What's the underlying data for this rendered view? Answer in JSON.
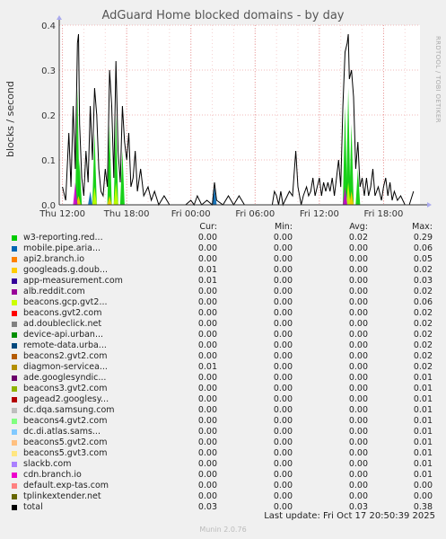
{
  "chart_data": {
    "type": "area",
    "title": "AdGuard Home blocked domains - by day",
    "ylabel": "blocks / second",
    "ylim": [
      0,
      0.4
    ],
    "yticks": [
      "0.0",
      "0.1",
      "0.2",
      "0.3",
      "0.4"
    ],
    "ytick_values": [
      0,
      0.1,
      0.2,
      0.3,
      0.4
    ],
    "xticks": [
      "Thu 12:00",
      "Thu 18:00",
      "Fri 00:00",
      "Fri 06:00",
      "Fri 12:00",
      "Fri 18:00"
    ],
    "xtick_hours": [
      0,
      6,
      12,
      18,
      24,
      30
    ],
    "xlim_hours": [
      -0.3,
      33.4
    ],
    "grid": true,
    "total_series": {
      "name": "total",
      "points": [
        [
          0.0,
          0.04
        ],
        [
          0.3,
          0.01
        ],
        [
          0.6,
          0.16
        ],
        [
          0.8,
          0.04
        ],
        [
          1.0,
          0.22
        ],
        [
          1.2,
          0.08
        ],
        [
          1.4,
          0.36
        ],
        [
          1.5,
          0.38
        ],
        [
          1.6,
          0.18
        ],
        [
          1.8,
          0.06
        ],
        [
          2.0,
          0.02
        ],
        [
          2.2,
          0.12
        ],
        [
          2.4,
          0.05
        ],
        [
          2.6,
          0.22
        ],
        [
          2.8,
          0.1
        ],
        [
          3.0,
          0.26
        ],
        [
          3.2,
          0.2
        ],
        [
          3.4,
          0.08
        ],
        [
          3.6,
          0.03
        ],
        [
          3.8,
          0.02
        ],
        [
          4.0,
          0.08
        ],
        [
          4.2,
          0.04
        ],
        [
          4.4,
          0.3
        ],
        [
          4.6,
          0.22
        ],
        [
          4.8,
          0.06
        ],
        [
          5.0,
          0.32
        ],
        [
          5.2,
          0.12
        ],
        [
          5.4,
          0.05
        ],
        [
          5.6,
          0.22
        ],
        [
          5.8,
          0.14
        ],
        [
          6.0,
          0.1
        ],
        [
          6.2,
          0.16
        ],
        [
          6.4,
          0.04
        ],
        [
          6.6,
          0.06
        ],
        [
          6.8,
          0.12
        ],
        [
          7.0,
          0.03
        ],
        [
          7.3,
          0.08
        ],
        [
          7.6,
          0.02
        ],
        [
          8.0,
          0.04
        ],
        [
          8.3,
          0.01
        ],
        [
          8.6,
          0.03
        ],
        [
          9.0,
          0.0
        ],
        [
          9.5,
          0.02
        ],
        [
          10.0,
          0.0
        ],
        [
          10.5,
          0.0
        ],
        [
          11.0,
          0.0
        ],
        [
          11.5,
          0.0
        ],
        [
          12.0,
          0.01
        ],
        [
          12.3,
          0.0
        ],
        [
          12.6,
          0.02
        ],
        [
          13.0,
          0.0
        ],
        [
          13.5,
          0.01
        ],
        [
          14.0,
          0.0
        ],
        [
          14.2,
          0.05
        ],
        [
          14.4,
          0.01
        ],
        [
          15.0,
          0.0
        ],
        [
          15.5,
          0.02
        ],
        [
          16.0,
          0.0
        ],
        [
          16.5,
          0.02
        ],
        [
          17.0,
          0.0
        ],
        [
          18.0,
          0.0
        ],
        [
          19.0,
          0.0
        ],
        [
          19.6,
          0.0
        ],
        [
          19.8,
          0.03
        ],
        [
          20.0,
          0.02
        ],
        [
          20.2,
          0.0
        ],
        [
          20.4,
          0.03
        ],
        [
          20.6,
          0.0
        ],
        [
          21.0,
          0.02
        ],
        [
          21.2,
          0.03
        ],
        [
          21.5,
          0.02
        ],
        [
          21.8,
          0.12
        ],
        [
          22.0,
          0.04
        ],
        [
          22.3,
          0.0
        ],
        [
          22.5,
          0.02
        ],
        [
          22.8,
          0.04
        ],
        [
          23.0,
          0.02
        ],
        [
          23.2,
          0.03
        ],
        [
          23.4,
          0.06
        ],
        [
          23.6,
          0.02
        ],
        [
          23.8,
          0.04
        ],
        [
          24.0,
          0.06
        ],
        [
          24.2,
          0.02
        ],
        [
          24.4,
          0.05
        ],
        [
          24.6,
          0.03
        ],
        [
          24.8,
          0.05
        ],
        [
          25.0,
          0.03
        ],
        [
          25.2,
          0.06
        ],
        [
          25.4,
          0.02
        ],
        [
          25.6,
          0.06
        ],
        [
          25.8,
          0.1
        ],
        [
          26.0,
          0.04
        ],
        [
          26.2,
          0.22
        ],
        [
          26.4,
          0.34
        ],
        [
          26.6,
          0.36
        ],
        [
          26.7,
          0.38
        ],
        [
          26.8,
          0.28
        ],
        [
          27.0,
          0.3
        ],
        [
          27.2,
          0.24
        ],
        [
          27.4,
          0.08
        ],
        [
          27.6,
          0.14
        ],
        [
          27.8,
          0.04
        ],
        [
          28.0,
          0.06
        ],
        [
          28.2,
          0.02
        ],
        [
          28.4,
          0.06
        ],
        [
          28.6,
          0.02
        ],
        [
          28.8,
          0.04
        ],
        [
          29.0,
          0.08
        ],
        [
          29.2,
          0.02
        ],
        [
          29.5,
          0.04
        ],
        [
          29.8,
          0.01
        ],
        [
          30.0,
          0.04
        ],
        [
          30.2,
          0.06
        ],
        [
          30.4,
          0.02
        ],
        [
          30.6,
          0.05
        ],
        [
          30.8,
          0.01
        ],
        [
          31.0,
          0.03
        ],
        [
          31.3,
          0.01
        ],
        [
          31.6,
          0.02
        ],
        [
          32.0,
          0.0
        ],
        [
          32.4,
          0.0
        ],
        [
          32.8,
          0.03
        ]
      ]
    },
    "stack_series": [
      {
        "name": "w3-reporting.red...",
        "color": "#00cc00",
        "points": [
          [
            1.4,
            0.26
          ],
          [
            1.6,
            0.1
          ],
          [
            3.0,
            0.16
          ],
          [
            4.4,
            0.18
          ],
          [
            5.0,
            0.2
          ],
          [
            5.6,
            0.12
          ],
          [
            26.4,
            0.22
          ],
          [
            26.7,
            0.26
          ],
          [
            27.0,
            0.18
          ],
          [
            27.6,
            0.08
          ]
        ]
      },
      {
        "name": "mobile.pipe.aria...",
        "color": "#0066b3",
        "points": [
          [
            2.6,
            0.03
          ],
          [
            14.2,
            0.04
          ],
          [
            26.6,
            0.03
          ]
        ]
      },
      {
        "name": "beacons.gcp.gvt2...",
        "color": "#ccff00",
        "points": [
          [
            3.0,
            0.04
          ],
          [
            5.0,
            0.05
          ],
          [
            26.7,
            0.05
          ]
        ]
      },
      {
        "name": "googleads.g.doub...",
        "color": "#ffcc00",
        "points": [
          [
            1.5,
            0.02
          ],
          [
            4.4,
            0.02
          ],
          [
            27.0,
            0.03
          ]
        ]
      },
      {
        "name": "ade.googlesyndic...",
        "color": "#cc00cc",
        "points": [
          [
            1.2,
            0.05
          ],
          [
            26.4,
            0.04
          ]
        ]
      }
    ],
    "series": [
      {
        "name": "w3-reporting.red...",
        "color": "#00cc00",
        "cur": "0.00",
        "min": "0.00",
        "avg": "0.02",
        "max": "0.29"
      },
      {
        "name": "mobile.pipe.aria...",
        "color": "#0066b3",
        "cur": "0.00",
        "min": "0.00",
        "avg": "0.00",
        "max": "0.06"
      },
      {
        "name": "api2.branch.io",
        "color": "#ff8000",
        "cur": "0.00",
        "min": "0.00",
        "avg": "0.00",
        "max": "0.05"
      },
      {
        "name": "googleads.g.doub...",
        "color": "#ffcc00",
        "cur": "0.01",
        "min": "0.00",
        "avg": "0.00",
        "max": "0.02"
      },
      {
        "name": "app-measurement.com",
        "color": "#330099",
        "cur": "0.01",
        "min": "0.00",
        "avg": "0.00",
        "max": "0.03"
      },
      {
        "name": "alb.reddit.com",
        "color": "#990099",
        "cur": "0.00",
        "min": "0.00",
        "avg": "0.00",
        "max": "0.02"
      },
      {
        "name": "beacons.gcp.gvt2...",
        "color": "#ccff00",
        "cur": "0.00",
        "min": "0.00",
        "avg": "0.00",
        "max": "0.06"
      },
      {
        "name": "beacons.gvt2.com",
        "color": "#ff0000",
        "cur": "0.00",
        "min": "0.00",
        "avg": "0.00",
        "max": "0.02"
      },
      {
        "name": "ad.doubleclick.net",
        "color": "#808080",
        "cur": "0.00",
        "min": "0.00",
        "avg": "0.00",
        "max": "0.02"
      },
      {
        "name": "device-api.urban...",
        "color": "#008f00",
        "cur": "0.00",
        "min": "0.00",
        "avg": "0.00",
        "max": "0.02"
      },
      {
        "name": "remote-data.urba...",
        "color": "#00487d",
        "cur": "0.00",
        "min": "0.00",
        "avg": "0.00",
        "max": "0.02"
      },
      {
        "name": "beacons2.gvt2.com",
        "color": "#b35a00",
        "cur": "0.00",
        "min": "0.00",
        "avg": "0.00",
        "max": "0.02"
      },
      {
        "name": "diagmon-servicea...",
        "color": "#b38f00",
        "cur": "0.01",
        "min": "0.00",
        "avg": "0.00",
        "max": "0.02"
      },
      {
        "name": "ade.googlesyndic...",
        "color": "#6b006b",
        "cur": "0.00",
        "min": "0.00",
        "avg": "0.00",
        "max": "0.01"
      },
      {
        "name": "beacons3.gvt2.com",
        "color": "#8fb300",
        "cur": "0.00",
        "min": "0.00",
        "avg": "0.00",
        "max": "0.01"
      },
      {
        "name": "pagead2.googlesy...",
        "color": "#b30000",
        "cur": "0.00",
        "min": "0.00",
        "avg": "0.00",
        "max": "0.01"
      },
      {
        "name": "dc.dqa.samsung.com",
        "color": "#bebebe",
        "cur": "0.00",
        "min": "0.00",
        "avg": "0.00",
        "max": "0.01"
      },
      {
        "name": "beacons4.gvt2.com",
        "color": "#80ff80",
        "cur": "0.00",
        "min": "0.00",
        "avg": "0.00",
        "max": "0.01"
      },
      {
        "name": "dc.di.atlas.sams...",
        "color": "#80c9ff",
        "cur": "0.00",
        "min": "0.00",
        "avg": "0.00",
        "max": "0.01"
      },
      {
        "name": "beacons5.gvt2.com",
        "color": "#ffc080",
        "cur": "0.00",
        "min": "0.00",
        "avg": "0.00",
        "max": "0.01"
      },
      {
        "name": "beacons5.gvt3.com",
        "color": "#ffe680",
        "cur": "0.00",
        "min": "0.00",
        "avg": "0.00",
        "max": "0.01"
      },
      {
        "name": "slackb.com",
        "color": "#aa80ff",
        "cur": "0.00",
        "min": "0.00",
        "avg": "0.00",
        "max": "0.01"
      },
      {
        "name": "cdn.branch.io",
        "color": "#ee00cc",
        "cur": "0.00",
        "min": "0.00",
        "avg": "0.00",
        "max": "0.01"
      },
      {
        "name": "default.exp-tas.com",
        "color": "#ff8080",
        "cur": "0.00",
        "min": "0.00",
        "avg": "0.00",
        "max": "0.00"
      },
      {
        "name": "tplinkextender.net",
        "color": "#666600",
        "cur": "0.00",
        "min": "0.00",
        "avg": "0.00",
        "max": "0.00"
      },
      {
        "name": "total",
        "color": "#000000",
        "cur": "0.03",
        "min": "0.00",
        "avg": "0.03",
        "max": "0.38"
      }
    ]
  },
  "legend_headers": {
    "cur": "Cur:",
    "min": "Min:",
    "avg": "Avg:",
    "max": "Max:"
  },
  "side_label": "RRDTOOL / TOBI OETIKER",
  "footer": "Last update: Fri Oct 17 20:50:39 2025",
  "version": "Munin 2.0.76"
}
